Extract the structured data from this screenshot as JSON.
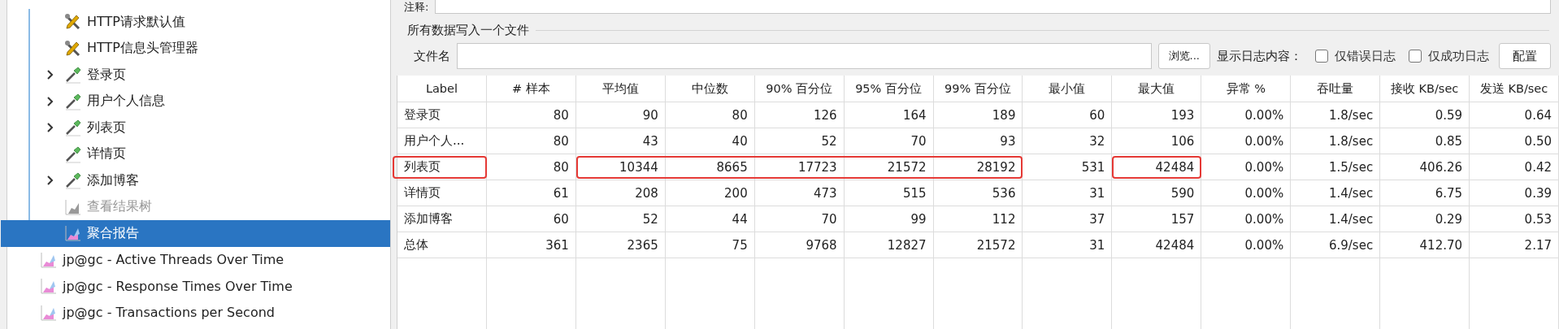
{
  "tree": {
    "group_children": [
      {
        "label": "HTTP请求默认值",
        "kind": "config",
        "expandable": false,
        "disabled": false,
        "selected": false
      },
      {
        "label": "HTTP信息头管理器",
        "kind": "config",
        "expandable": false,
        "disabled": false,
        "selected": false
      },
      {
        "label": "登录页",
        "kind": "sampler",
        "expandable": true,
        "disabled": false,
        "selected": false
      },
      {
        "label": "用户个人信息",
        "kind": "sampler",
        "expandable": true,
        "disabled": false,
        "selected": false
      },
      {
        "label": "列表页",
        "kind": "sampler",
        "expandable": true,
        "disabled": false,
        "selected": false
      },
      {
        "label": "详情页",
        "kind": "sampler",
        "expandable": false,
        "disabled": false,
        "selected": false
      },
      {
        "label": "添加博客",
        "kind": "sampler",
        "expandable": true,
        "disabled": false,
        "selected": false
      },
      {
        "label": "查看结果树",
        "kind": "listener",
        "expandable": false,
        "disabled": true,
        "selected": false
      },
      {
        "label": "聚合报告",
        "kind": "listener",
        "expandable": false,
        "disabled": false,
        "selected": true
      }
    ],
    "items": [
      {
        "label": "jp@gc - Active Threads Over Time",
        "kind": "listener",
        "expandable": false,
        "disabled": false,
        "selected": false
      },
      {
        "label": "jp@gc - Response Times Over Time",
        "kind": "listener",
        "expandable": false,
        "disabled": false,
        "selected": false
      },
      {
        "label": "jp@gc - Transactions per Second",
        "kind": "listener",
        "expandable": false,
        "disabled": false,
        "selected": false
      }
    ]
  },
  "comment_field": {
    "label": "注释:"
  },
  "file_section": {
    "title": "所有数据写入一个文件",
    "file_label": "文件名",
    "browse_button": "浏览...",
    "log_label": "显示日志内容：",
    "options": [
      {
        "label": "仅错误日志",
        "checked": false
      },
      {
        "label": "仅成功日志",
        "checked": false
      }
    ],
    "config_button": "配置"
  },
  "table": {
    "columns": [
      "Label",
      "# 样本",
      "平均值",
      "中位数",
      "90% 百分位",
      "95% 百分位",
      "99% 百分位",
      "最小值",
      "最大值",
      "异常 %",
      "吞吐量",
      "接收 KB/sec",
      "发送 KB/sec"
    ],
    "rows": [
      {
        "cells": [
          "登录页",
          "80",
          "90",
          "80",
          "126",
          "164",
          "189",
          "60",
          "193",
          "0.00%",
          "1.8/sec",
          "0.59",
          "0.64"
        ],
        "marked": [
          false,
          false,
          false,
          false,
          false,
          false,
          false,
          false,
          false,
          false,
          false,
          false,
          false
        ]
      },
      {
        "cells": [
          "用户个人...",
          "80",
          "43",
          "40",
          "52",
          "70",
          "93",
          "32",
          "106",
          "0.00%",
          "1.8/sec",
          "0.85",
          "0.50"
        ],
        "marked": [
          false,
          false,
          false,
          false,
          false,
          false,
          false,
          false,
          false,
          false,
          false,
          false,
          false
        ]
      },
      {
        "cells": [
          "列表页",
          "80",
          "10344",
          "8665",
          "17723",
          "21572",
          "28192",
          "531",
          "42484",
          "0.00%",
          "1.5/sec",
          "406.26",
          "0.42"
        ],
        "marked": [
          true,
          false,
          true,
          true,
          true,
          true,
          true,
          false,
          true,
          false,
          false,
          false,
          false
        ]
      },
      {
        "cells": [
          "详情页",
          "61",
          "208",
          "200",
          "473",
          "515",
          "536",
          "31",
          "590",
          "0.00%",
          "1.4/sec",
          "6.75",
          "0.39"
        ],
        "marked": [
          false,
          false,
          false,
          false,
          false,
          false,
          false,
          false,
          false,
          false,
          false,
          false,
          false
        ]
      },
      {
        "cells": [
          "添加博客",
          "60",
          "52",
          "44",
          "70",
          "99",
          "112",
          "37",
          "157",
          "0.00%",
          "1.4/sec",
          "0.29",
          "0.53"
        ],
        "marked": [
          false,
          false,
          false,
          false,
          false,
          false,
          false,
          false,
          false,
          false,
          false,
          false,
          false
        ]
      },
      {
        "cells": [
          "总体",
          "361",
          "2365",
          "75",
          "9768",
          "12827",
          "21572",
          "31",
          "42484",
          "0.00%",
          "6.9/sec",
          "412.70",
          "2.17"
        ],
        "marked": [
          false,
          false,
          false,
          false,
          false,
          false,
          false,
          false,
          false,
          false,
          false,
          false,
          false
        ]
      }
    ]
  }
}
